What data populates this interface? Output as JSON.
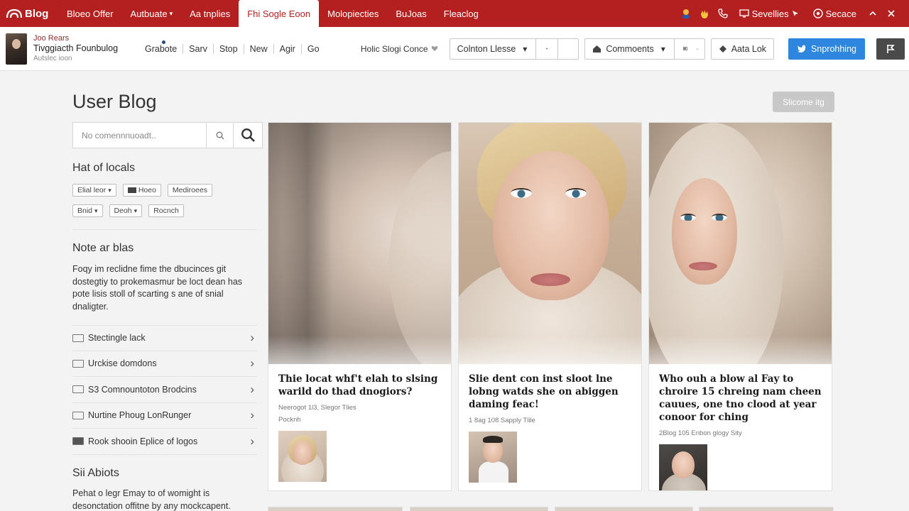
{
  "colors": {
    "brand_red": "#b3201f",
    "primary_blue": "#2e86de",
    "dark_button": "#4a4a4a"
  },
  "topnav": {
    "logo_text": "Blog",
    "links": [
      {
        "label": "Bloeo Offer",
        "active": false,
        "caret": false
      },
      {
        "label": "Autbuate",
        "active": false,
        "caret": true
      },
      {
        "label": "Aa tnplies",
        "active": false,
        "caret": false
      },
      {
        "label": "Fhi Sogle Eoon",
        "active": true,
        "caret": false
      },
      {
        "label": "Molopiecties",
        "active": false,
        "caret": false
      },
      {
        "label": "BuJoas",
        "active": false,
        "caret": false
      },
      {
        "label": "Fleaclog",
        "active": false,
        "caret": false
      }
    ],
    "right_icons": [
      "user-badge-icon",
      "hand-icon",
      "phone-icon"
    ],
    "settings_label": "Sevellies",
    "account_label": "Secace"
  },
  "subbar": {
    "profile": {
      "name": "Joo Rears",
      "title": "Tivggiacth Founbulog",
      "sub": "Autslec ioon"
    },
    "links": [
      "Grabote",
      "Sarv",
      "Stop",
      "New",
      "Agir",
      "Go"
    ],
    "filter_label": "Holic Slogi Conce",
    "dropdown_label": "Colnton Llesse",
    "comments_label": "Commoents",
    "action_label": "Aata Lok",
    "primary_label": "Snprohhing"
  },
  "main": {
    "title": "User Blog",
    "ghost_button": "Slicome itg",
    "search_placeholder": "No comennnuoadt..",
    "section1": {
      "heading": "Hat of locals",
      "chips_row1": [
        {
          "label": "Elial leor",
          "caret": true,
          "flag": false
        },
        {
          "label": "Hoeo",
          "caret": false,
          "flag": true
        },
        {
          "label": "Mediroees",
          "caret": false,
          "flag": false
        }
      ],
      "chips_row2": [
        {
          "label": "Bnid",
          "caret": true,
          "flag": false
        },
        {
          "label": "Deoh",
          "caret": true,
          "flag": false
        },
        {
          "label": "Rocnch",
          "caret": false,
          "flag": false
        }
      ]
    },
    "section2": {
      "heading": "Note ar blas",
      "text": "Foqy im reclidne fime the dbucinces git dostegtiy to prokemasmur be loct dean has pote lisis stoll of scarting s ane of snial dnaligter."
    },
    "list": [
      {
        "label": "Stectingle lack",
        "dark": false
      },
      {
        "label": "Urckise domdons",
        "dark": false
      },
      {
        "label": "S3 Comnountoton Brodcins",
        "dark": false
      },
      {
        "label": "Nurtine Phoug LonRunger",
        "dark": false
      },
      {
        "label": "Rook shooin Eplice of logos",
        "dark": true
      }
    ],
    "section3": {
      "heading": "Sii Abiots",
      "text": "Pehat o legr Emay to of womight is desonctation offitne by any mockcapent."
    }
  },
  "cards": [
    {
      "title": "Thie locat whf't elah to slsing warild do thad dnogiors?",
      "meta": "Neerogot 1l3, Slegor Tlies",
      "meta2": "Pocknh"
    },
    {
      "title": "Slie dent con inst sloot lne lobng watds she on abiggen daming feac!",
      "meta": "1 8ag 108 Sapply Tlile",
      "meta2": ""
    },
    {
      "title": "Who ouh a blow al Fay to chroire 15 chreing nam cheen cauues, one tno clood at year conoor for ching",
      "meta": "2Blog 105 Enbon glogy Sity",
      "meta2": ""
    }
  ]
}
